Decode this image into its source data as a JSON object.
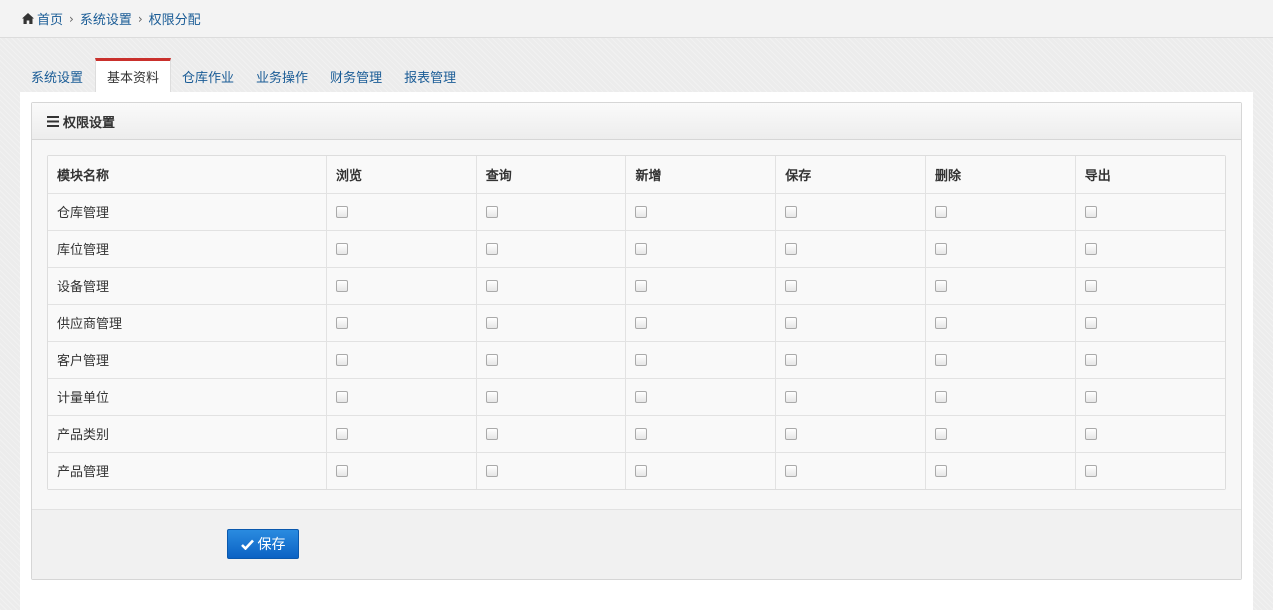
{
  "breadcrumb": {
    "home": "首页",
    "level1": "系统设置",
    "level2": "权限分配"
  },
  "tabs": [
    {
      "label": "系统设置",
      "active": false
    },
    {
      "label": "基本资料",
      "active": true
    },
    {
      "label": "仓库作业",
      "active": false
    },
    {
      "label": "业务操作",
      "active": false
    },
    {
      "label": "财务管理",
      "active": false
    },
    {
      "label": "报表管理",
      "active": false
    }
  ],
  "panel": {
    "title": "权限设置"
  },
  "table": {
    "columns": [
      "模块名称",
      "浏览",
      "查询",
      "新增",
      "保存",
      "删除",
      "导出"
    ],
    "rows": [
      {
        "name": "仓库管理"
      },
      {
        "name": "库位管理"
      },
      {
        "name": "设备管理"
      },
      {
        "name": "供应商管理"
      },
      {
        "name": "客户管理"
      },
      {
        "name": "计量单位"
      },
      {
        "name": "产品类别"
      },
      {
        "name": "产品管理"
      }
    ]
  },
  "actions": {
    "save_label": "保存"
  },
  "colors": {
    "accent": "#0b62c4",
    "tab_active_border": "#c9302c",
    "link": "#1a5c96"
  }
}
